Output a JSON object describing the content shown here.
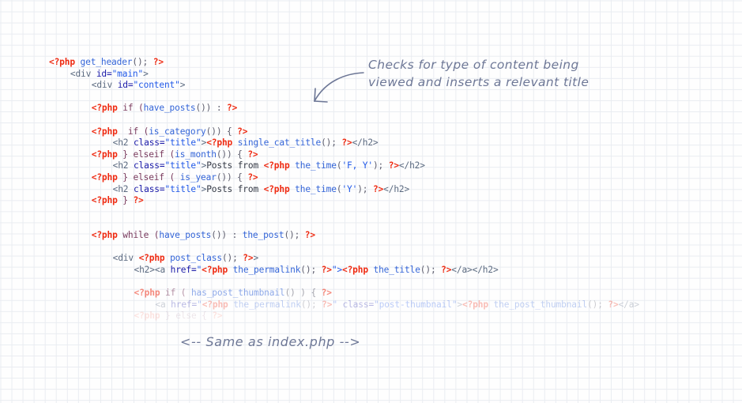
{
  "page": {
    "background": "#fefefe",
    "grid_color": "#e9ecf1",
    "ink_color": "#6d7796"
  },
  "annotations": {
    "top_note_line1": "Checks for type of content being",
    "top_note_line2": "viewed and inserts a relevant title",
    "bottom_note": "<-- Same as index.php -->",
    "arrow": "curved-arrow-down-left"
  },
  "code": {
    "language": "php-html",
    "lines": [
      {
        "indent": 0,
        "opacity": 1,
        "tokens": [
          {
            "t": "<?php",
            "c": "php"
          },
          {
            "t": " get_header",
            "c": "fn"
          },
          {
            "t": "(); ",
            "c": "punc"
          },
          {
            "t": "?>",
            "c": "php"
          }
        ]
      },
      {
        "indent": 4,
        "opacity": 1,
        "tokens": [
          {
            "t": "<div ",
            "c": "tag"
          },
          {
            "t": "id=",
            "c": "attr"
          },
          {
            "t": "\"main\"",
            "c": "str"
          },
          {
            "t": ">",
            "c": "tag"
          }
        ]
      },
      {
        "indent": 8,
        "opacity": 1,
        "tokens": [
          {
            "t": "<div ",
            "c": "tag"
          },
          {
            "t": "id=",
            "c": "attr"
          },
          {
            "t": "\"content\"",
            "c": "str"
          },
          {
            "t": ">",
            "c": "tag"
          }
        ]
      },
      {
        "blank": true
      },
      {
        "indent": 8,
        "opacity": 1,
        "tokens": [
          {
            "t": "<?php",
            "c": "php"
          },
          {
            "t": " if (",
            "c": "kw"
          },
          {
            "t": "have_posts",
            "c": "fn"
          },
          {
            "t": "()) : ",
            "c": "punc"
          },
          {
            "t": "?>",
            "c": "php"
          }
        ]
      },
      {
        "blank": true
      },
      {
        "indent": 8,
        "opacity": 1,
        "tokens": [
          {
            "t": "<?php",
            "c": "php"
          },
          {
            "t": "  if (",
            "c": "kw"
          },
          {
            "t": "is_category",
            "c": "fn"
          },
          {
            "t": "()) { ",
            "c": "punc"
          },
          {
            "t": "?>",
            "c": "php"
          }
        ]
      },
      {
        "indent": 12,
        "opacity": 1,
        "tokens": [
          {
            "t": "<h2 ",
            "c": "tag"
          },
          {
            "t": "class=",
            "c": "attr"
          },
          {
            "t": "\"title\"",
            "c": "str"
          },
          {
            "t": ">",
            "c": "tag"
          },
          {
            "t": "<?php",
            "c": "php"
          },
          {
            "t": " single_cat_title",
            "c": "fn"
          },
          {
            "t": "(); ",
            "c": "punc"
          },
          {
            "t": "?>",
            "c": "php"
          },
          {
            "t": "</h2>",
            "c": "tag"
          }
        ]
      },
      {
        "indent": 8,
        "opacity": 1,
        "tokens": [
          {
            "t": "<?php",
            "c": "php"
          },
          {
            "t": " } elseif (",
            "c": "kw"
          },
          {
            "t": "is_month",
            "c": "fn"
          },
          {
            "t": "()) { ",
            "c": "punc"
          },
          {
            "t": "?>",
            "c": "php"
          }
        ]
      },
      {
        "indent": 12,
        "opacity": 1,
        "tokens": [
          {
            "t": "<h2 ",
            "c": "tag"
          },
          {
            "t": "class=",
            "c": "attr"
          },
          {
            "t": "\"title\"",
            "c": "str"
          },
          {
            "t": ">",
            "c": "tag"
          },
          {
            "t": "Posts from ",
            "c": "txt"
          },
          {
            "t": "<?php",
            "c": "php"
          },
          {
            "t": " the_time",
            "c": "fn"
          },
          {
            "t": "(",
            "c": "punc"
          },
          {
            "t": "'F, Y'",
            "c": "str"
          },
          {
            "t": "); ",
            "c": "punc"
          },
          {
            "t": "?>",
            "c": "php"
          },
          {
            "t": "</h2>",
            "c": "tag"
          }
        ]
      },
      {
        "indent": 8,
        "opacity": 1,
        "tokens": [
          {
            "t": "<?php",
            "c": "php"
          },
          {
            "t": " } elseif ( ",
            "c": "kw"
          },
          {
            "t": "is_year",
            "c": "fn"
          },
          {
            "t": "()) { ",
            "c": "punc"
          },
          {
            "t": "?>",
            "c": "php"
          }
        ]
      },
      {
        "indent": 12,
        "opacity": 1,
        "tokens": [
          {
            "t": "<h2 ",
            "c": "tag"
          },
          {
            "t": "class=",
            "c": "attr"
          },
          {
            "t": "\"title\"",
            "c": "str"
          },
          {
            "t": ">",
            "c": "tag"
          },
          {
            "t": "Posts from ",
            "c": "txt"
          },
          {
            "t": "<?php",
            "c": "php"
          },
          {
            "t": " the_time",
            "c": "fn"
          },
          {
            "t": "(",
            "c": "punc"
          },
          {
            "t": "'Y'",
            "c": "str"
          },
          {
            "t": "); ",
            "c": "punc"
          },
          {
            "t": "?>",
            "c": "php"
          },
          {
            "t": "</h2>",
            "c": "tag"
          }
        ]
      },
      {
        "indent": 8,
        "opacity": 1,
        "tokens": [
          {
            "t": "<?php",
            "c": "php"
          },
          {
            "t": " } ",
            "c": "kw"
          },
          {
            "t": "?>",
            "c": "php"
          }
        ]
      },
      {
        "blank": true
      },
      {
        "blank": true
      },
      {
        "indent": 8,
        "opacity": 1,
        "tokens": [
          {
            "t": "<?php",
            "c": "php"
          },
          {
            "t": " while (",
            "c": "kw"
          },
          {
            "t": "have_posts",
            "c": "fn"
          },
          {
            "t": "()) : ",
            "c": "punc"
          },
          {
            "t": "the_post",
            "c": "fn"
          },
          {
            "t": "(); ",
            "c": "punc"
          },
          {
            "t": "?>",
            "c": "php"
          }
        ]
      },
      {
        "blank": true
      },
      {
        "indent": 12,
        "opacity": 1,
        "tokens": [
          {
            "t": "<div ",
            "c": "tag"
          },
          {
            "t": "<?php",
            "c": "php"
          },
          {
            "t": " post_class",
            "c": "fn"
          },
          {
            "t": "(); ",
            "c": "punc"
          },
          {
            "t": "?>",
            "c": "php"
          },
          {
            "t": ">",
            "c": "tag"
          }
        ]
      },
      {
        "indent": 16,
        "opacity": 1,
        "tokens": [
          {
            "t": "<h2><a ",
            "c": "tag"
          },
          {
            "t": "href=",
            "c": "attr"
          },
          {
            "t": "\"",
            "c": "str"
          },
          {
            "t": "<?php",
            "c": "php"
          },
          {
            "t": " the_permalink",
            "c": "fn"
          },
          {
            "t": "(); ",
            "c": "punc"
          },
          {
            "t": "?>",
            "c": "php"
          },
          {
            "t": "\">",
            "c": "str"
          },
          {
            "t": "<?php",
            "c": "php"
          },
          {
            "t": " the_title",
            "c": "fn"
          },
          {
            "t": "(); ",
            "c": "punc"
          },
          {
            "t": "?>",
            "c": "php"
          },
          {
            "t": "</a></h2>",
            "c": "tag"
          }
        ]
      },
      {
        "blank": true
      },
      {
        "indent": 16,
        "opacity": 0.55,
        "tokens": [
          {
            "t": "<?php",
            "c": "php"
          },
          {
            "t": " if ( ",
            "c": "kw"
          },
          {
            "t": "has_post_thumbnail",
            "c": "fn"
          },
          {
            "t": "() ) { ",
            "c": "punc"
          },
          {
            "t": "?>",
            "c": "php"
          }
        ]
      },
      {
        "indent": 20,
        "opacity": 0.3,
        "tokens": [
          {
            "t": "<a ",
            "c": "tag"
          },
          {
            "t": "href=",
            "c": "attr"
          },
          {
            "t": "\"",
            "c": "str"
          },
          {
            "t": "<?php",
            "c": "php"
          },
          {
            "t": " the_permalink",
            "c": "fn"
          },
          {
            "t": "(); ",
            "c": "punc"
          },
          {
            "t": "?>",
            "c": "php"
          },
          {
            "t": "\" ",
            "c": "str"
          },
          {
            "t": "class=",
            "c": "attr"
          },
          {
            "t": "\"post-thumbnail\"",
            "c": "str"
          },
          {
            "t": ">",
            "c": "tag"
          },
          {
            "t": "<?php",
            "c": "php"
          },
          {
            "t": " the_post_thumbnail",
            "c": "fn"
          },
          {
            "t": "(); ",
            "c": "punc"
          },
          {
            "t": "?>",
            "c": "php"
          },
          {
            "t": "</a>",
            "c": "tag"
          }
        ]
      },
      {
        "indent": 16,
        "opacity": 0.12,
        "tokens": [
          {
            "t": "<?php",
            "c": "php"
          },
          {
            "t": " } else { ",
            "c": "kw"
          },
          {
            "t": "?>",
            "c": "php"
          }
        ]
      }
    ]
  }
}
